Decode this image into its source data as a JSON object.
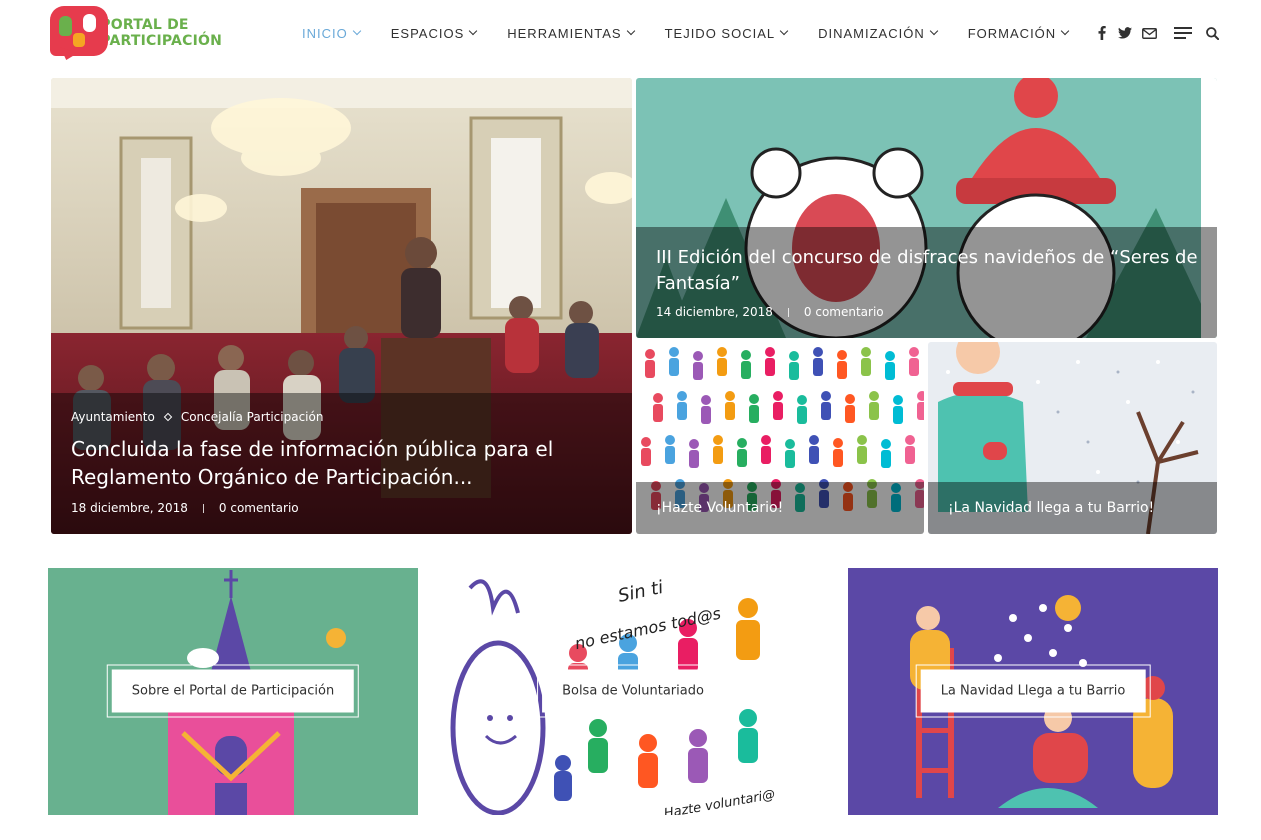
{
  "brand": {
    "logo_line1": "PORTAL DE",
    "logo_line2": "PARTICIPACIÓN"
  },
  "nav": {
    "items": [
      {
        "label": "INICIO",
        "active": true
      },
      {
        "label": "ESPACIOS"
      },
      {
        "label": "HERRAMIENTAS"
      },
      {
        "label": "TEJIDO SOCIAL"
      },
      {
        "label": "DINAMIZACIÓN"
      },
      {
        "label": "FORMACIÓN"
      }
    ],
    "icons": [
      "facebook-icon",
      "twitter-icon",
      "envelope-icon",
      "menu-icon",
      "search-icon"
    ]
  },
  "featured": {
    "main": {
      "categories": [
        "Ayuntamiento",
        "Concejalía Participación"
      ],
      "title": "Concluida la fase de información pública para el Reglamento Orgánico de Participación...",
      "date": "18 diciembre, 2018",
      "comments": "0 comentario"
    },
    "top_right": {
      "title": "III Edición del concurso de disfraces navideños de “Seres de Fantasía”",
      "date": "14 diciembre, 2018",
      "comments": "0 comentario"
    },
    "bottom_left": {
      "title": "¡Hazte Voluntario!"
    },
    "bottom_right": {
      "title": "¡La Navidad llega a tu Barrio!"
    }
  },
  "promos": [
    {
      "label": "Sobre el Portal de Participación"
    },
    {
      "label": "Bolsa de Voluntariado",
      "image_text_1": "Sin ti",
      "image_text_2": "no estamos tod@s",
      "image_text_3": "Hazte voluntari@"
    },
    {
      "label": "La Navidad Llega a tu Barrio"
    }
  ],
  "image_texts": {
    "volunteer_tile": "Hazte voluntari@"
  },
  "colors": {
    "accent": "#6aa9d8",
    "brand_green": "#6ab04c",
    "brand_red": "#e63b4d",
    "promo1_bg": "#68b18f",
    "promo3_bg": "#5b48a6"
  }
}
